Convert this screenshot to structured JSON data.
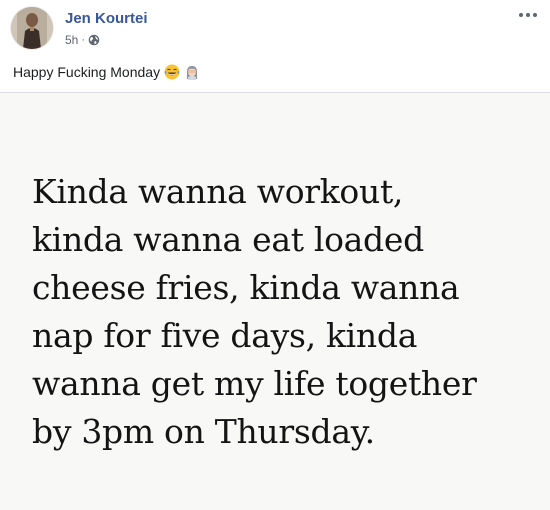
{
  "post": {
    "author": "Jen Kourtei",
    "time": "5h",
    "separator": "·",
    "privacy_icon": "globe-icon",
    "more_icon": "more-options-icon",
    "caption": "Happy Fucking Monday",
    "caption_emojis": [
      "tears-of-joy-emoji",
      "woman-facepalming-emoji"
    ]
  },
  "photo": {
    "lines": [
      "Kinda wanna workout,",
      "kinda wanna eat loaded",
      "cheese fries, kinda wanna",
      "nap for five days, kinda",
      "wanna get my life together",
      "by 3pm on Thursday."
    ]
  },
  "colors": {
    "author_link": "#385898",
    "meta_gray": "#616770",
    "text": "#1c1e21",
    "divider": "#dadde1"
  }
}
